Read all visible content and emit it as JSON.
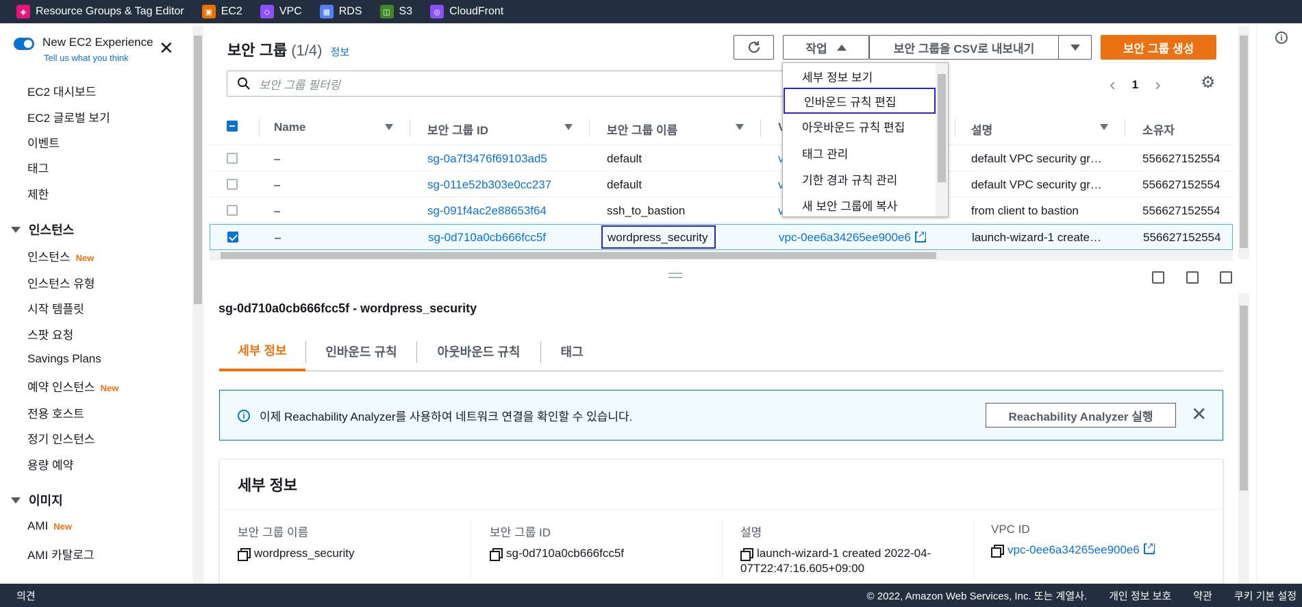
{
  "topbar": {
    "favorites": [
      {
        "label": "Resource Groups & Tag Editor",
        "icon": "resource-groups-icon",
        "color": "#e7157b"
      },
      {
        "label": "EC2",
        "icon": "ec2-icon",
        "color": "#ed7100"
      },
      {
        "label": "VPC",
        "icon": "vpc-icon",
        "color": "#8c4fff"
      },
      {
        "label": "RDS",
        "icon": "rds-icon",
        "color": "#527fff"
      },
      {
        "label": "S3",
        "icon": "s3-icon",
        "color": "#3f8624"
      },
      {
        "label": "CloudFront",
        "icon": "cloudfront-icon",
        "color": "#8c4fff"
      }
    ]
  },
  "sidebar": {
    "new_experience": "New EC2 Experience",
    "feedback_link": "Tell us what you think",
    "items_top": [
      "EC2 대시보드",
      "EC2 글로벌 보기",
      "이벤트",
      "태그",
      "제한"
    ],
    "section_instances": "인스턴스",
    "instances_items": [
      {
        "label": "인스턴스",
        "badge": "New"
      },
      {
        "label": "인스턴스 유형",
        "badge": ""
      },
      {
        "label": "시작 템플릿",
        "badge": ""
      },
      {
        "label": "스팟 요청",
        "badge": ""
      },
      {
        "label": "Savings Plans",
        "badge": ""
      },
      {
        "label": "예약 인스턴스",
        "badge": "New"
      },
      {
        "label": "전용 호스트",
        "badge": ""
      },
      {
        "label": "정기 인스턴스",
        "badge": ""
      },
      {
        "label": "용량 예약",
        "badge": ""
      }
    ],
    "section_images": "이미지",
    "images_items": [
      {
        "label": "AMI",
        "badge": "New"
      },
      {
        "label": "AMI 카탈로그",
        "badge": ""
      }
    ]
  },
  "header": {
    "title": "보안 그룹",
    "count": "(1/4)",
    "info": "정보",
    "actions_label": "작업",
    "export_label": "보안 그룹을 CSV로 내보내기",
    "create_label": "보안 그룹 생성",
    "search_placeholder": "보안 그룹 필터링",
    "page": "1"
  },
  "actions_menu": [
    "세부 정보 보기",
    "인바운드 규칙 편집",
    "아웃바운드 규칙 편집",
    "태그 관리",
    "기한 경과 규칙 관리",
    "새 보안 그룹에 복사"
  ],
  "table": {
    "columns": [
      "Name",
      "보안 그룹 ID",
      "보안 그룹 이름",
      "V",
      "설명",
      "소유자"
    ],
    "rows": [
      {
        "name": "–",
        "id": "sg-0a7f3476f69103ad5",
        "group_name": "default",
        "vpc": "v",
        "desc": "default VPC security gr…",
        "owner": "556627152554",
        "selected": false
      },
      {
        "name": "–",
        "id": "sg-011e52b303e0cc237",
        "group_name": "default",
        "vpc": "v",
        "desc": "default VPC security gr…",
        "owner": "556627152554",
        "selected": false
      },
      {
        "name": "–",
        "id": "sg-091f4ac2e88653f64",
        "group_name": "ssh_to_bastion",
        "vpc": "v",
        "desc": "from client to bastion",
        "owner": "556627152554",
        "selected": false
      },
      {
        "name": "–",
        "id": "sg-0d710a0cb666fcc5f",
        "group_name": "wordpress_security",
        "vpc": "vpc-0ee6a34265ee900e6",
        "desc": "launch-wizard-1 create…",
        "owner": "556627152554",
        "selected": true
      }
    ]
  },
  "detail": {
    "title": "sg-0d710a0cb666fcc5f - wordpress_security",
    "tabs": [
      "세부 정보",
      "인바운드 규칙",
      "아웃바운드 규칙",
      "태그"
    ],
    "alert_text": "이제 Reachability Analyzer를 사용하여 네트워크 연결을 확인할 수 있습니다.",
    "alert_button": "Reachability Analyzer 실행",
    "section_title": "세부 정보",
    "fields": [
      {
        "key": "보안 그룹 이름",
        "value": "wordpress_security"
      },
      {
        "key": "보안 그룹 ID",
        "value": "sg-0d710a0cb666fcc5f"
      },
      {
        "key": "설명",
        "value": "launch-wizard-1 created 2022-04-",
        "value2": "07T22:47:16.605+09:00"
      },
      {
        "key": "VPC ID",
        "value": "vpc-0ee6a34265ee900e6"
      }
    ]
  },
  "footer": {
    "feedback": "의견",
    "copyright": "© 2022, Amazon Web Services, Inc. 또는 계열사.",
    "privacy": "개인 정보 보호",
    "terms": "약관",
    "cookies": "쿠키 기본 설정"
  },
  "colors": {
    "accent": "#ec7211",
    "link": "#0972d3",
    "nav_bg": "#232f3e"
  }
}
